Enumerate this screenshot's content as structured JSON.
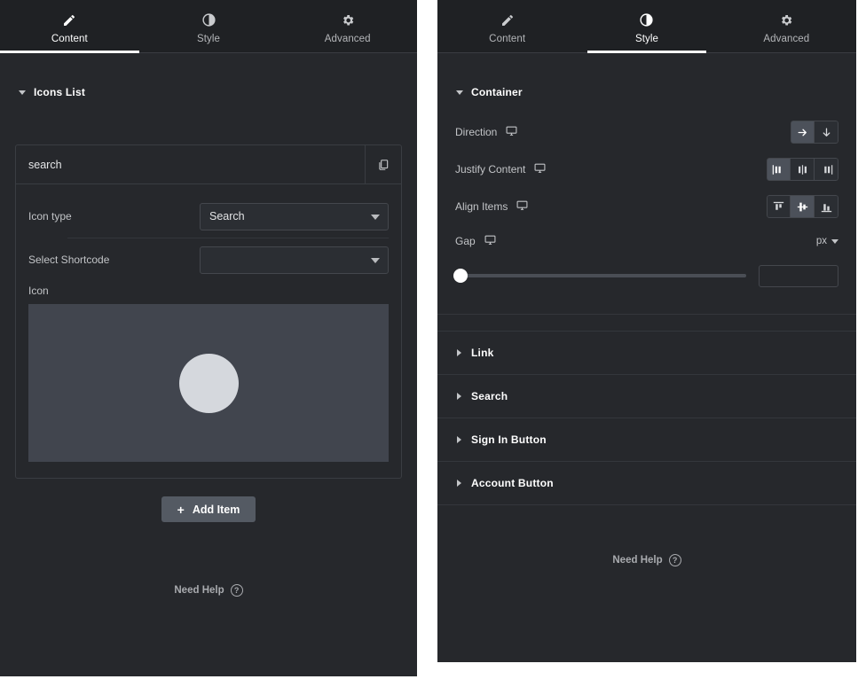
{
  "left_panel": {
    "tabs": [
      {
        "label": "Content",
        "icon": "pencil-icon",
        "active": true
      },
      {
        "label": "Style",
        "icon": "contrast-icon",
        "active": false
      },
      {
        "label": "Advanced",
        "icon": "gear-icon",
        "active": false
      }
    ],
    "section": {
      "title": "Icons List",
      "expanded": true
    },
    "repeater": {
      "item_title": "search",
      "duplicate_icon": "duplicate-icon",
      "fields": [
        {
          "label": "Icon type",
          "value": "Search",
          "placeholder": ""
        },
        {
          "label": "Select Shortcode",
          "value": "",
          "placeholder": ""
        }
      ],
      "icon_field_label": "Icon",
      "icon_preview": {
        "background": "#41454e",
        "shape": "circle",
        "shape_color": "#d5d8dd"
      }
    },
    "add_item_button": {
      "label": "Add Item",
      "icon": "plus-icon"
    },
    "need_help": {
      "label": "Need Help",
      "icon": "question-circle-icon"
    }
  },
  "right_panel": {
    "tabs": [
      {
        "label": "Content",
        "icon": "pencil-icon",
        "active": false
      },
      {
        "label": "Style",
        "icon": "contrast-icon",
        "active": true
      },
      {
        "label": "Advanced",
        "icon": "gear-icon",
        "active": false
      }
    ],
    "container_section": {
      "title": "Container",
      "expanded": true,
      "controls": [
        {
          "label": "Direction",
          "device_icon": "desktop-icon",
          "options": [
            "row",
            "column"
          ],
          "option_icons": [
            "arrow-right-icon",
            "arrow-down-icon"
          ],
          "selected_index": 0
        },
        {
          "label": "Justify Content",
          "device_icon": "desktop-icon",
          "options": [
            "flex-start",
            "center",
            "flex-end"
          ],
          "option_icons": [
            "justify-start-icon",
            "justify-center-icon",
            "justify-end-icon"
          ],
          "selected_index": 0
        },
        {
          "label": "Align Items",
          "device_icon": "desktop-icon",
          "options": [
            "flex-start",
            "center",
            "flex-end"
          ],
          "option_icons": [
            "align-top-icon",
            "align-middle-icon",
            "align-bottom-icon"
          ],
          "selected_index": 1
        }
      ],
      "gap": {
        "label": "Gap",
        "device_icon": "desktop-icon",
        "unit": "px",
        "value": "",
        "slider_percent": 0
      }
    },
    "collapsed_sections": [
      {
        "title": "Link",
        "expanded": false
      },
      {
        "title": "Search",
        "expanded": false
      },
      {
        "title": "Sign In Button",
        "expanded": false
      },
      {
        "title": "Account Button",
        "expanded": false
      }
    ],
    "need_help": {
      "label": "Need Help",
      "icon": "question-circle-icon"
    }
  },
  "theme": {
    "panel_bg": "#26282c",
    "tabbar_bg": "#1f2124",
    "border": "#3a3d42",
    "accent_active": "#ffffff",
    "button_bg": "#545a63",
    "preview_bg": "#41454e"
  }
}
